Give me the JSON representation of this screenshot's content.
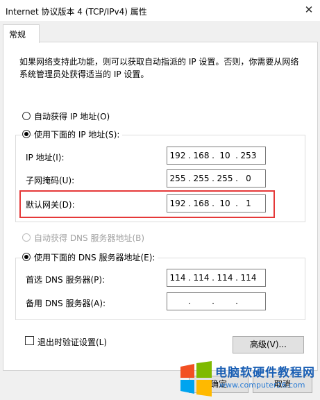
{
  "window": {
    "title": "Internet 协议版本 4 (TCP/IPv4) 属性",
    "close_glyph": "✕"
  },
  "tab": {
    "label": "常规"
  },
  "description": "如果网络支持此功能，则可以获取自动指派的 IP 设置。否则，你需要从网络系统管理员处获得适当的 IP 设置。",
  "ip_section": {
    "auto_label": "自动获得 IP 地址(O)",
    "manual_label": "使用下面的 IP 地址(S):",
    "fields": [
      {
        "label": "IP 地址(I):",
        "octets": [
          "192",
          "168",
          "10",
          "253"
        ]
      },
      {
        "label": "子网掩码(U):",
        "octets": [
          "255",
          "255",
          "255",
          "0"
        ]
      },
      {
        "label": "默认网关(D):",
        "octets": [
          "192",
          "168",
          "10",
          "1"
        ]
      }
    ]
  },
  "dns_section": {
    "auto_label": "自动获得 DNS 服务器地址(B)",
    "manual_label": "使用下面的 DNS 服务器地址(E):",
    "fields": [
      {
        "label": "首选 DNS 服务器(P):",
        "octets": [
          "114",
          "114",
          "114",
          "114"
        ]
      },
      {
        "label": "备用 DNS 服务器(A):",
        "octets": [
          "",
          "",
          "",
          ""
        ]
      }
    ]
  },
  "validate_label": "退出时验证设置(L)",
  "buttons": {
    "advanced": "高级(V)...",
    "ok": "确定",
    "cancel": "取消"
  },
  "watermark": {
    "title": "电脑软硬件教程网",
    "url": "www.computer26.com"
  },
  "colors": {
    "highlight": "#e53838",
    "watermark": "#1a5fb4"
  }
}
